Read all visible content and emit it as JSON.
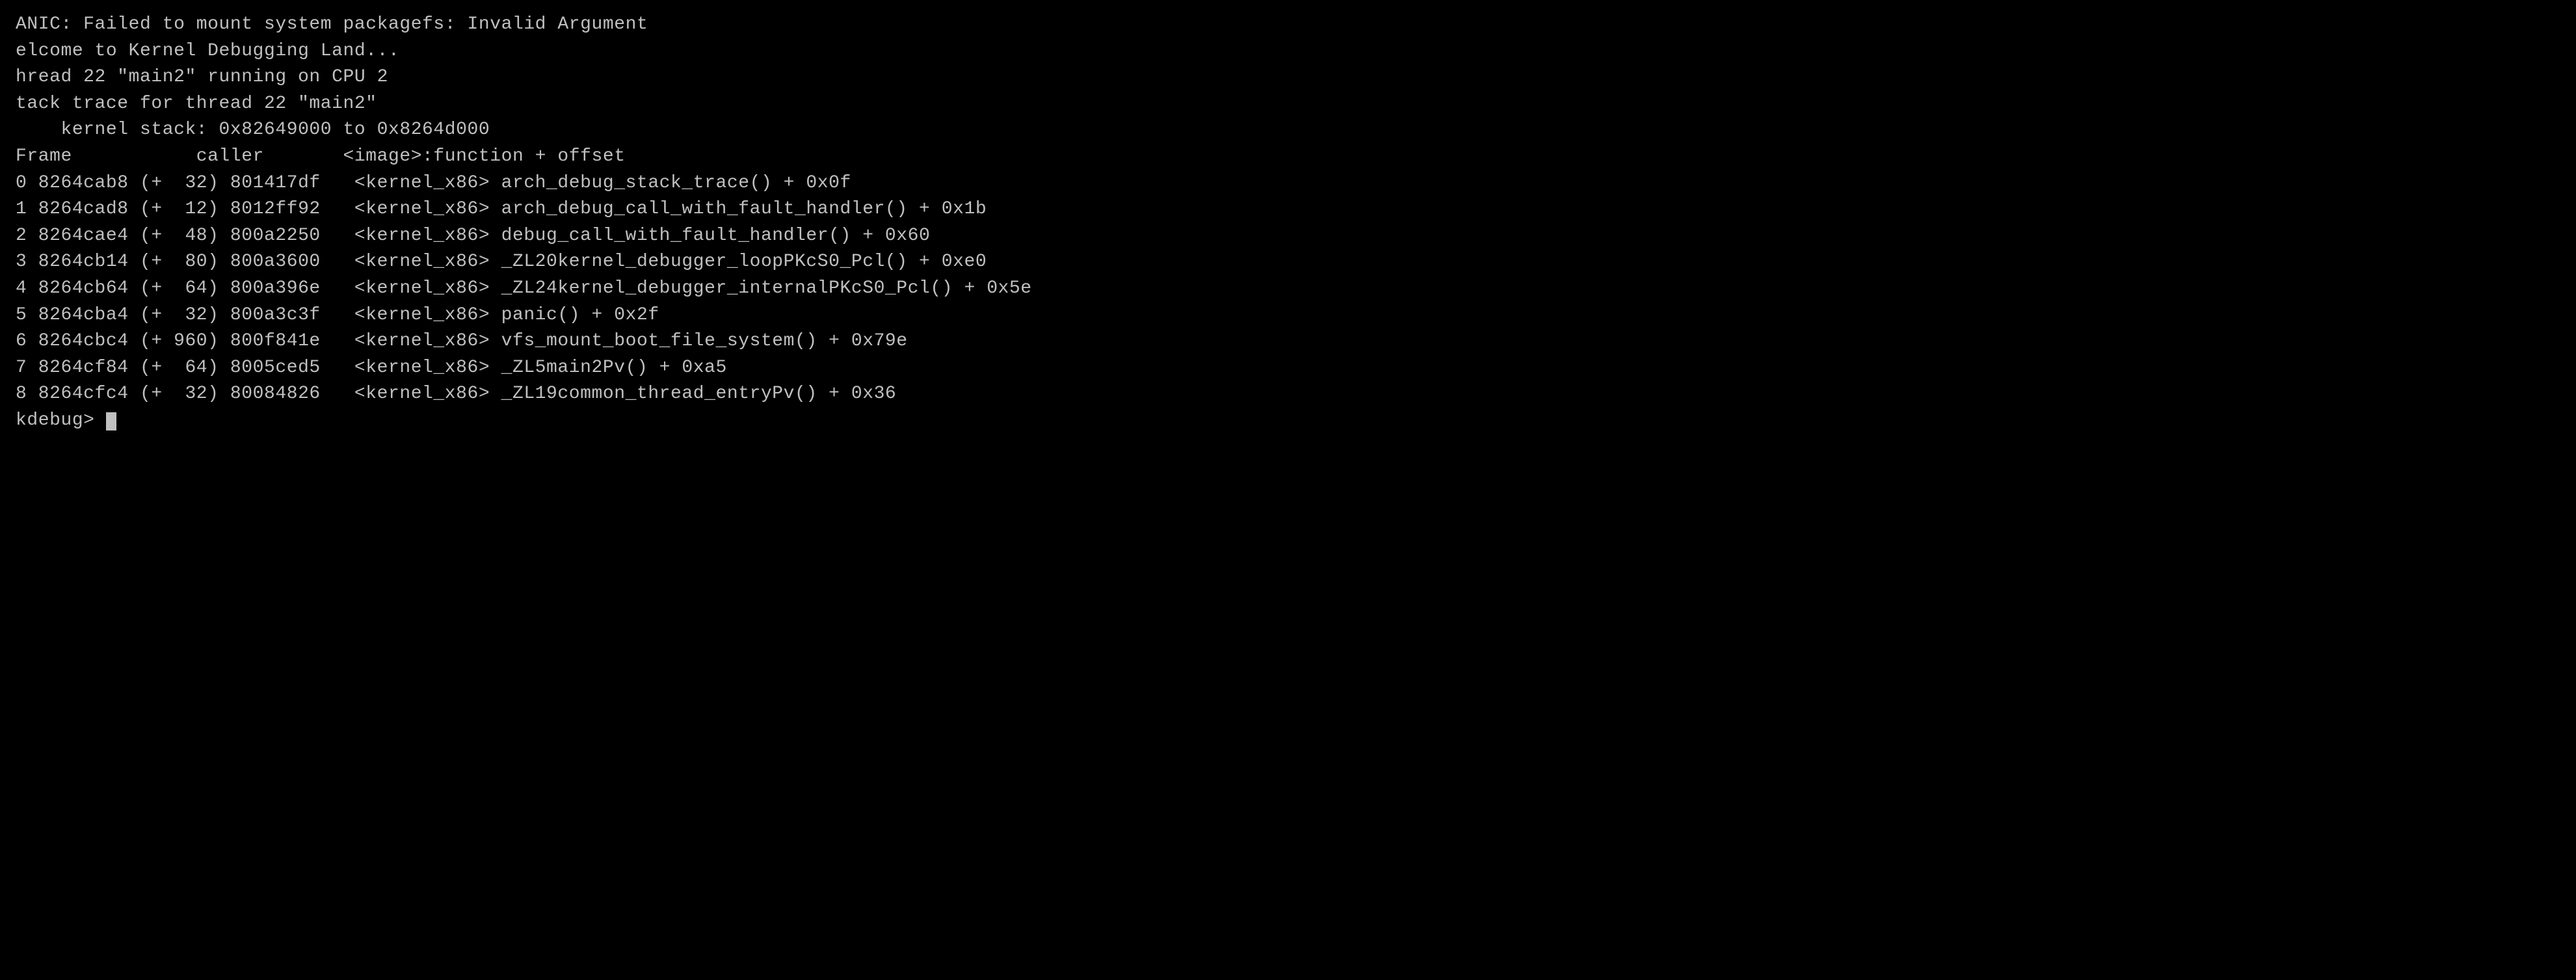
{
  "terminal": {
    "lines": [
      {
        "id": "line1",
        "text": "ANIC: Failed to mount system packagefs: Invalid Argument"
      },
      {
        "id": "line2",
        "text": "elcome to Kernel Debugging Land..."
      },
      {
        "id": "line3",
        "text": "hread 22 \"main2\" running on CPU 2"
      },
      {
        "id": "line4",
        "text": "tack trace for thread 22 \"main2\""
      },
      {
        "id": "line5",
        "text": "    kernel stack: 0x82649000 to 0x8264d000"
      },
      {
        "id": "line6",
        "text": "Frame           caller       <image>:function + offset"
      },
      {
        "id": "line7",
        "text": "0 8264cab8 (+  32) 801417df   <kernel_x86> arch_debug_stack_trace() + 0x0f"
      },
      {
        "id": "line8",
        "text": "1 8264cad8 (+  12) 8012ff92   <kernel_x86> arch_debug_call_with_fault_handler() + 0x1b"
      },
      {
        "id": "line9",
        "text": "2 8264cae4 (+  48) 800a2250   <kernel_x86> debug_call_with_fault_handler() + 0x60"
      },
      {
        "id": "line10",
        "text": "3 8264cb14 (+  80) 800a3600   <kernel_x86> _ZL20kernel_debugger_loopPKcS0_Pcl() + 0xe0"
      },
      {
        "id": "line11",
        "text": "4 8264cb64 (+  64) 800a396e   <kernel_x86> _ZL24kernel_debugger_internalPKcS0_Pcl() + 0x5e"
      },
      {
        "id": "line12",
        "text": "5 8264cba4 (+  32) 800a3c3f   <kernel_x86> panic() + 0x2f"
      },
      {
        "id": "line13",
        "text": "6 8264cbc4 (+ 960) 800f841e   <kernel_x86> vfs_mount_boot_file_system() + 0x79e"
      },
      {
        "id": "line14",
        "text": "7 8264cf84 (+  64) 8005ced5   <kernel_x86> _ZL5main2Pv() + 0xa5"
      },
      {
        "id": "line15",
        "text": "8 8264cfc4 (+  32) 80084826   <kernel_x86> _ZL19common_thread_entryPv() + 0x36"
      },
      {
        "id": "line16",
        "text": "kdebug> "
      }
    ]
  }
}
